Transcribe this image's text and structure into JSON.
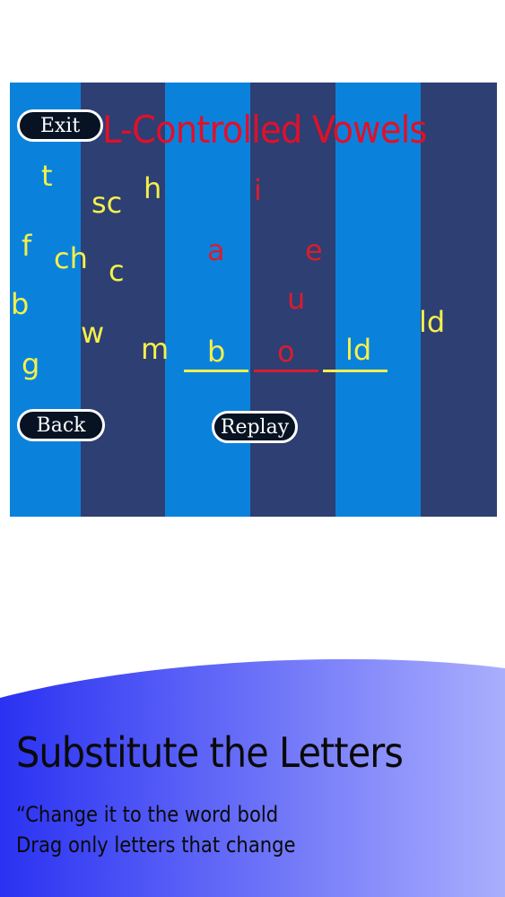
{
  "game": {
    "title": "L-Controlled Vowels",
    "exit_label": "Exit",
    "back_label": "Back",
    "replay_label": "Replay",
    "yellow_letters": [
      "t",
      "sc",
      "h",
      "f",
      "ch",
      "c",
      "b",
      "w",
      "m",
      "g",
      "ld"
    ],
    "red_letters": [
      "i",
      "a",
      "e",
      "u"
    ],
    "word_slots": [
      "b",
      "o",
      "ld"
    ]
  },
  "footer": {
    "heading": "Substitute the Letters",
    "line1": "“Change it to the word bold",
    "line2": "Drag only letters that change"
  },
  "colors": {
    "stripe_light": "#0a82dc",
    "stripe_dark": "#2d3f73",
    "title": "#e0102a",
    "letter_yellow": "#f5f04a",
    "letter_red": "#d81d2f"
  }
}
